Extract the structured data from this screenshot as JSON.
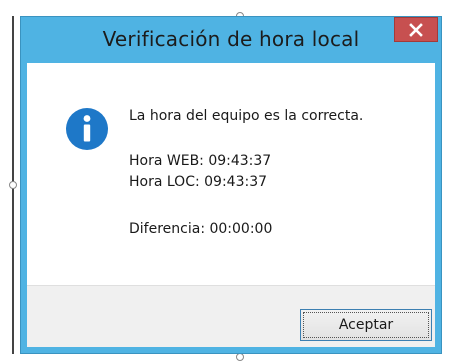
{
  "window": {
    "title": "Verificación de hora local",
    "close_glyph": "×"
  },
  "message": {
    "icon": "info-icon",
    "line1": "La hora del equipo es la correcta.",
    "web_time": "Hora WEB: 09:43:37",
    "loc_time": "Hora LOC: 09:43:37",
    "difference": "Diferencia: 00:00:00"
  },
  "buttons": {
    "ok_label": "Aceptar"
  },
  "colors": {
    "titlebar": "#4fb3e3",
    "close_button": "#c75050",
    "info_icon": "#1e78c8",
    "button_border": "#3c7fb1"
  }
}
